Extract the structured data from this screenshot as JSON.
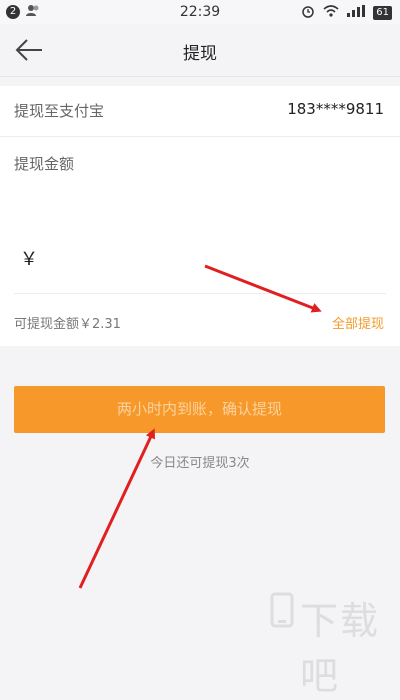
{
  "status_bar": {
    "notification_count": "2",
    "time": "22:39",
    "battery": "61",
    "icons": [
      "contacts-icon",
      "alarm-icon",
      "wifi-icon",
      "signal-icon",
      "battery-icon"
    ]
  },
  "nav": {
    "title": "提现",
    "back_icon": "back-arrow-icon"
  },
  "form": {
    "alipay_label": "提现至支付宝",
    "account": "183****9811",
    "amount_label": "提现金额",
    "currency_symbol": "￥",
    "available_text": "可提现金额￥2.31",
    "withdraw_all_label": "全部提现"
  },
  "confirm_button": "两小时内到账，确认提现",
  "remaining_text": "今日还可提现3次",
  "watermark": "下载吧",
  "colors": {
    "accent": "#f6982a",
    "arrow": "#e02020",
    "background": "#f4f4f6"
  }
}
